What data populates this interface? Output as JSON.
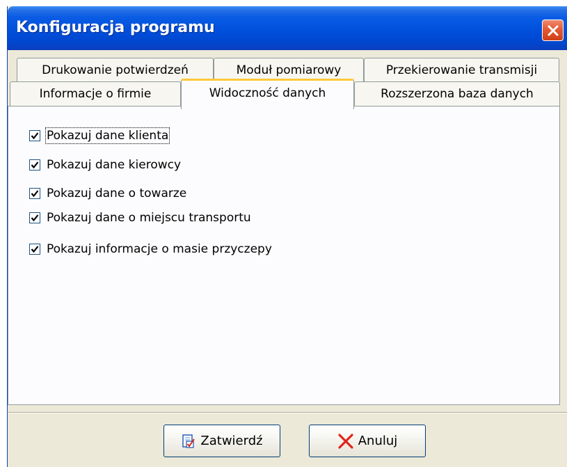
{
  "window": {
    "title": "Konfiguracja programu"
  },
  "tabs": {
    "row1": [
      {
        "label": "Drukowanie potwierdzeń"
      },
      {
        "label": "Moduł pomiarowy"
      },
      {
        "label": "Przekierowanie transmisji"
      }
    ],
    "row2": [
      {
        "label": "Informacje o firmie"
      },
      {
        "label": "Widoczność danych",
        "selected": true
      },
      {
        "label": "Rozszerzona baza danych"
      }
    ]
  },
  "options": [
    {
      "label": "Pokazuj dane klienta",
      "checked": true,
      "focused": true
    },
    {
      "label": "Pokazuj dane kierowcy",
      "checked": true
    },
    {
      "label": "Pokazuj dane o towarze",
      "checked": true
    },
    {
      "label": "Pokazuj dane o miejscu transportu",
      "checked": true
    },
    {
      "label": "Pokazuj informacje o masie przyczepy",
      "checked": true
    }
  ],
  "buttons": {
    "confirm": {
      "label": "Zatwierdź",
      "icon": "document-check-icon"
    },
    "cancel": {
      "label": "Anuluj",
      "icon": "red-x-icon"
    }
  },
  "colors": {
    "titlebar": "#0050dc",
    "dialog_face": "#ece9d8",
    "tab_highlight": "#ffc83c",
    "close_button": "#e45a35"
  }
}
